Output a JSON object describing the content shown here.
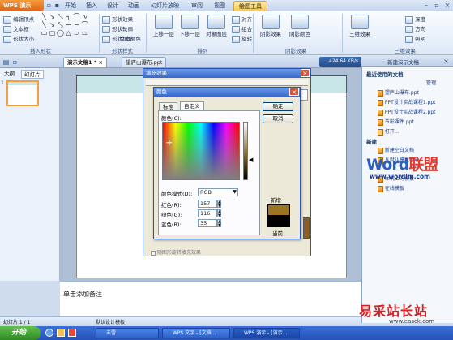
{
  "titlebar": {
    "app_button": "WPS 演示",
    "tabs": [
      "开始",
      "插入",
      "设计",
      "动画",
      "幻灯片放映",
      "审阅",
      "视图",
      "绘图工具"
    ],
    "active_tab": "绘图工具"
  },
  "ribbon": {
    "insert_shapes": {
      "label": "插入形状",
      "items": [
        "编辑顶点",
        "文本框",
        "形状大小"
      ]
    },
    "shape_styles": {
      "label": "形状样式",
      "items": [
        "形状效果",
        "形状轮廓",
        "形状填充",
        "文本颜色"
      ]
    },
    "arrange": {
      "label": "排列",
      "items": [
        "上移一层",
        "下移一层",
        "对象图层",
        "对齐",
        "组合",
        "旋转"
      ]
    },
    "shadow": {
      "label": "阴影效果",
      "items": [
        "阴影效果",
        "阴影颜色"
      ]
    },
    "three_d": {
      "label": "三维效果",
      "items": [
        "三维效果",
        "深度",
        "方向",
        "照明"
      ]
    }
  },
  "docbar": {
    "tabs": [
      "演示文稿1 *",
      "望庐山瀑布.ppt"
    ],
    "speed": "424.64 KB/s"
  },
  "left_panel": {
    "tabs": [
      "大纲",
      "幻灯片"
    ],
    "slide_number": "1"
  },
  "fill_dialog": {
    "title": "填充效果",
    "checkbox": "随图形旋转填充效果"
  },
  "color_dialog": {
    "title": "颜色",
    "tabs": [
      "标准",
      "自定义"
    ],
    "colors_label": "颜色(C):",
    "model_label": "颜色模式(D):",
    "model_value": "RGB",
    "red_label": "红色(R):",
    "red_value": "157",
    "green_label": "绿色(G):",
    "green_value": "116",
    "blue_label": "蓝色(B):",
    "blue_value": "35",
    "ok": "确定",
    "cancel": "取消",
    "new_label": "新增",
    "current_label": "当前",
    "new_color": "#9d7423",
    "current_color": "#000000"
  },
  "right_pane": {
    "title": "新建演示文稿",
    "recent_head": "最近使用的文档",
    "manage": "管理",
    "recent_docs": [
      "望庐山瀑布.ppt",
      "PPT设计实战课程1.ppt",
      "PPT设计实战课程2.ppt",
      "节影课件.ppt",
      "打开..."
    ],
    "new_head": "新建",
    "new_items": [
      "新建空白文档",
      "从默认模板新建",
      "本机上的模板",
      "在线模板"
    ]
  },
  "notes": {
    "placeholder": "单击添加备注"
  },
  "statusbar": {
    "slide": "幻灯片 1 / 1",
    "template": "默认设计模板"
  },
  "taskbar": {
    "start": "开始",
    "items": [
      "未雪",
      "WPS 文字 - [文档...",
      "WPS 演示 - [演示..."
    ]
  },
  "watermark": {
    "word_part1": "Word",
    "word_part2": "联盟",
    "url": "www.wordlm.com",
    "site": "易采站长站",
    "easck": "www.easck.com"
  }
}
